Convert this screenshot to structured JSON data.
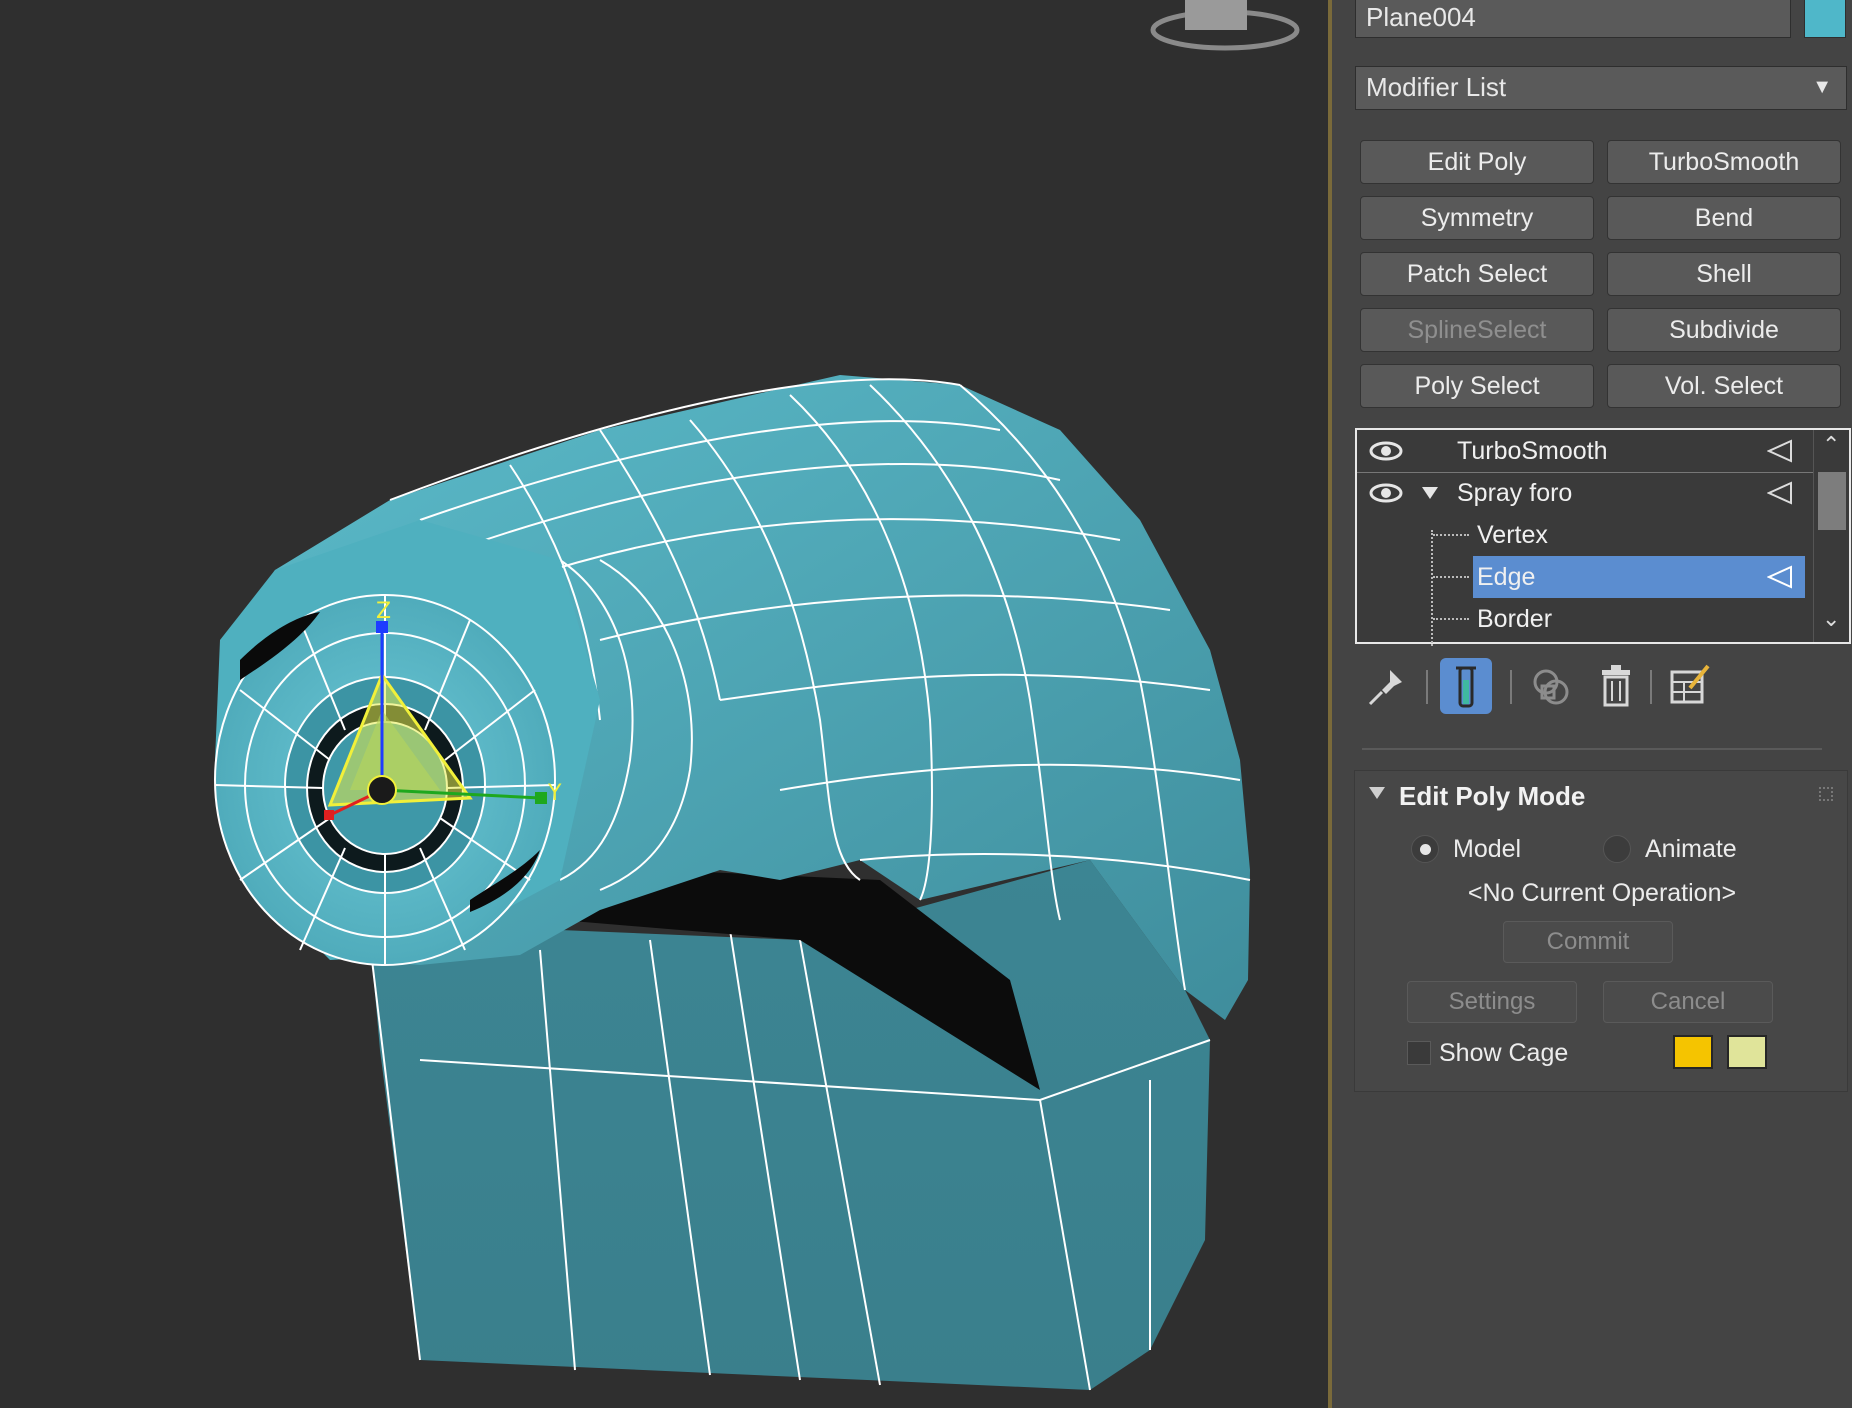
{
  "object": {
    "name": "Plane004",
    "color": "#4fb7c9"
  },
  "modifier_list": {
    "label": "Modifier List",
    "arrow": "▼"
  },
  "modifier_buttons": [
    {
      "label": "Edit Poly",
      "enabled": true
    },
    {
      "label": "TurboSmooth",
      "enabled": true
    },
    {
      "label": "Symmetry",
      "enabled": true
    },
    {
      "label": "Bend",
      "enabled": true
    },
    {
      "label": "Patch Select",
      "enabled": true
    },
    {
      "label": "Shell",
      "enabled": true
    },
    {
      "label": "SplineSelect",
      "enabled": false
    },
    {
      "label": "Subdivide",
      "enabled": true
    },
    {
      "label": "Poly Select",
      "enabled": true
    },
    {
      "label": "Vol. Select",
      "enabled": true
    }
  ],
  "stack": {
    "items": [
      {
        "label": "TurboSmooth",
        "eye": true,
        "expand": false,
        "level": 0
      },
      {
        "label": "Spray foro",
        "eye": true,
        "expand": true,
        "level": 0
      },
      {
        "label": "Vertex",
        "level": 1
      },
      {
        "label": "Edge",
        "level": 1,
        "selected": true
      },
      {
        "label": "Border",
        "level": 1
      }
    ]
  },
  "stack_tools": [
    "pin-stack-icon",
    "show-end-result-icon",
    "make-unique-icon",
    "remove-modifier-icon",
    "configure-modifier-sets-icon"
  ],
  "rollout": {
    "title": "Edit Poly Mode",
    "mode_model": "Model",
    "mode_animate": "Animate",
    "current_operation": "<No Current Operation>",
    "commit": "Commit",
    "settings": "Settings",
    "cancel": "Cancel",
    "show_cage": "Show Cage",
    "cage_colors": [
      "#f5c400",
      "#e0e49a"
    ]
  },
  "viewport": {
    "mesh_color": "#4aa3b2",
    "gizmo_axes": [
      "Z",
      "Y",
      "X"
    ]
  }
}
